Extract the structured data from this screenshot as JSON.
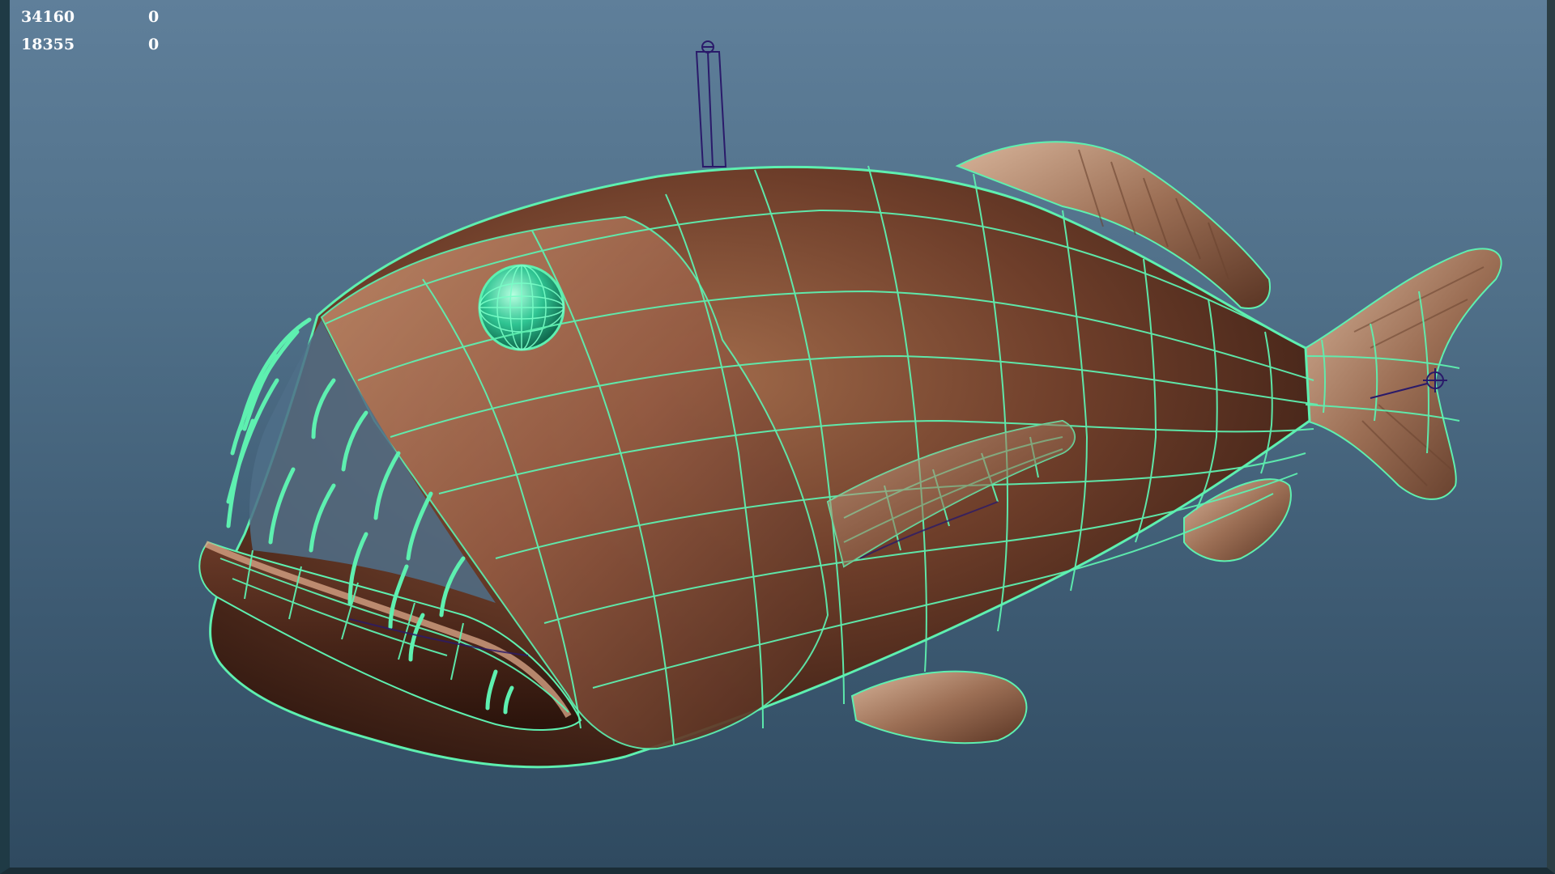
{
  "viewport": {
    "background_top": "#5f7f9a",
    "background_bottom": "#2f4a60",
    "wireframe_color": "#5ef0b0",
    "texture_color": "#7a4a32"
  },
  "hud": {
    "rows": [
      {
        "label": "34160",
        "value": "0"
      },
      {
        "label": "18355",
        "value": "0"
      }
    ]
  },
  "model": {
    "icon": "anglerfish-model"
  }
}
